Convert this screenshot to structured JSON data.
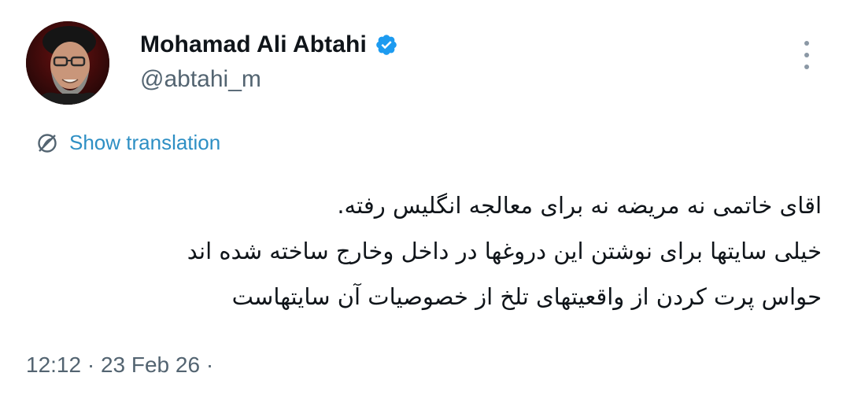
{
  "author": {
    "display_name": "Mohamad Ali Abtahi",
    "handle": "@abtahi_m",
    "verified_icon": "verified-badge-icon",
    "avatar": "profile-photo"
  },
  "translate": {
    "label": "Show translation",
    "icon": "translate-globe-icon"
  },
  "tweet": {
    "lines": [
      "اقای خاتمی نه مریضه نه برای معالجه انگلیس رفته.",
      "خیلی سایتها برای نوشتن این دروغها در داخل وخارج ساخته شده اند",
      "حواس پرت کردن از واقعیتهای تلخ از خصوصیات آن سایتهاست"
    ],
    "meta": "12:12 · 23 Feb 26 ·"
  },
  "colors": {
    "link": "#2e8fc4",
    "secondary_text": "#536471",
    "verified": "#1d9bf0"
  }
}
